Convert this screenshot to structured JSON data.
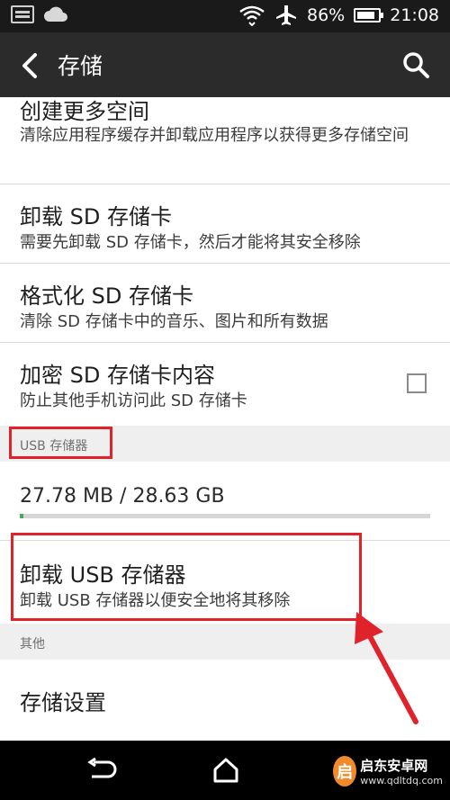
{
  "status_bar": {
    "battery": "86%",
    "time": "21:08",
    "battery_level": 0.86
  },
  "header": {
    "title": "存储"
  },
  "items": [
    {
      "title": "创建更多空间",
      "subtitle": "清除应用程序缓存并卸载应用程序以获得更多存储空间"
    },
    {
      "title": "卸载 SD 存储卡",
      "subtitle": "需要先卸载 SD 存储卡，然后才能将其安全移除"
    },
    {
      "title": "格式化 SD 存储卡",
      "subtitle": "清除 SD 存储卡中的音乐、图片和所有数据"
    },
    {
      "title": "加密 SD 存储卡内容",
      "subtitle": "防止其他手机访问此 SD 存储卡",
      "checked": false
    }
  ],
  "usb_section": {
    "label": "USB 存储器",
    "usage_text": "27.78 MB / 28.63 GB",
    "usage_fraction": 0.001,
    "unmount_title": "卸载 USB 存储器",
    "unmount_subtitle": "卸载 USB 存储器以便安全地将其移除"
  },
  "other_section": {
    "label": "其他",
    "settings_title": "存储设置"
  },
  "watermark": {
    "name": "启东安卓网",
    "url": "www.qdltdq.com"
  },
  "colors": {
    "status_bar_bg": "#1a1a1a",
    "action_bar_bg": "#2b2b2b",
    "section_bg": "#efefef",
    "usage_green": "#4aa860",
    "highlight_red": "#e0222b"
  }
}
